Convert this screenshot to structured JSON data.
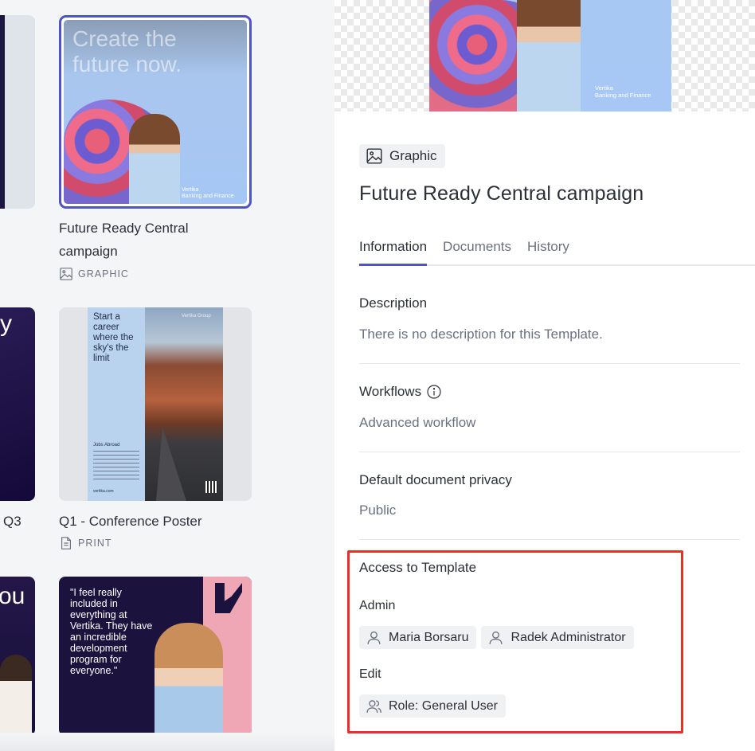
{
  "gallery": {
    "cards": [
      {
        "title_lines": [
          "Future Ready Central",
          "campaign"
        ],
        "type": "GRAPHIC",
        "thumb_text_lines": [
          "Create the",
          "future now."
        ],
        "brand_lines": [
          "Vertika",
          "Banking and Finance"
        ]
      },
      {
        "title": "Q1 - Conference Poster",
        "type": "PRINT",
        "thumb_text_lines": [
          "Start a",
          "career",
          "where the",
          "sky's the",
          "limit"
        ],
        "thumb_sub": "Jobs Abroad",
        "thumb_brand": "Vertika Group",
        "thumb_url": "vertika.com"
      },
      {
        "quote_lines": [
          "\"I feel really",
          "included in",
          "everything at",
          "Vertika. They have",
          "an incredible",
          "development",
          "program for",
          "everyone.\""
        ]
      }
    ],
    "partial_left": {
      "mid_text": "y",
      "mid_caption": "Q3",
      "bottom_text": "ou"
    }
  },
  "panel": {
    "preview_brand_lines": [
      "Vertika",
      "Banking and Finance"
    ],
    "type_chip": "Graphic",
    "title": "Future Ready Central campaign",
    "tabs": [
      {
        "label": "Information",
        "active": true
      },
      {
        "label": "Documents",
        "active": false
      },
      {
        "label": "History",
        "active": false
      }
    ],
    "description": {
      "label": "Description",
      "value": "There is no description for this Template."
    },
    "workflows": {
      "label": "Workflows",
      "value": "Advanced workflow"
    },
    "privacy": {
      "label": "Default document privacy",
      "value": "Public"
    },
    "access": {
      "label": "Access to Template",
      "admin_label": "Admin",
      "admins": [
        "Maria Borsaru",
        "Radek Administrator"
      ],
      "edit_label": "Edit",
      "editors": [
        "Role: General User"
      ]
    }
  },
  "colors": {
    "accent": "#4f53c9",
    "highlight": "#e8302a",
    "chip_bg": "#f0f1f3"
  }
}
